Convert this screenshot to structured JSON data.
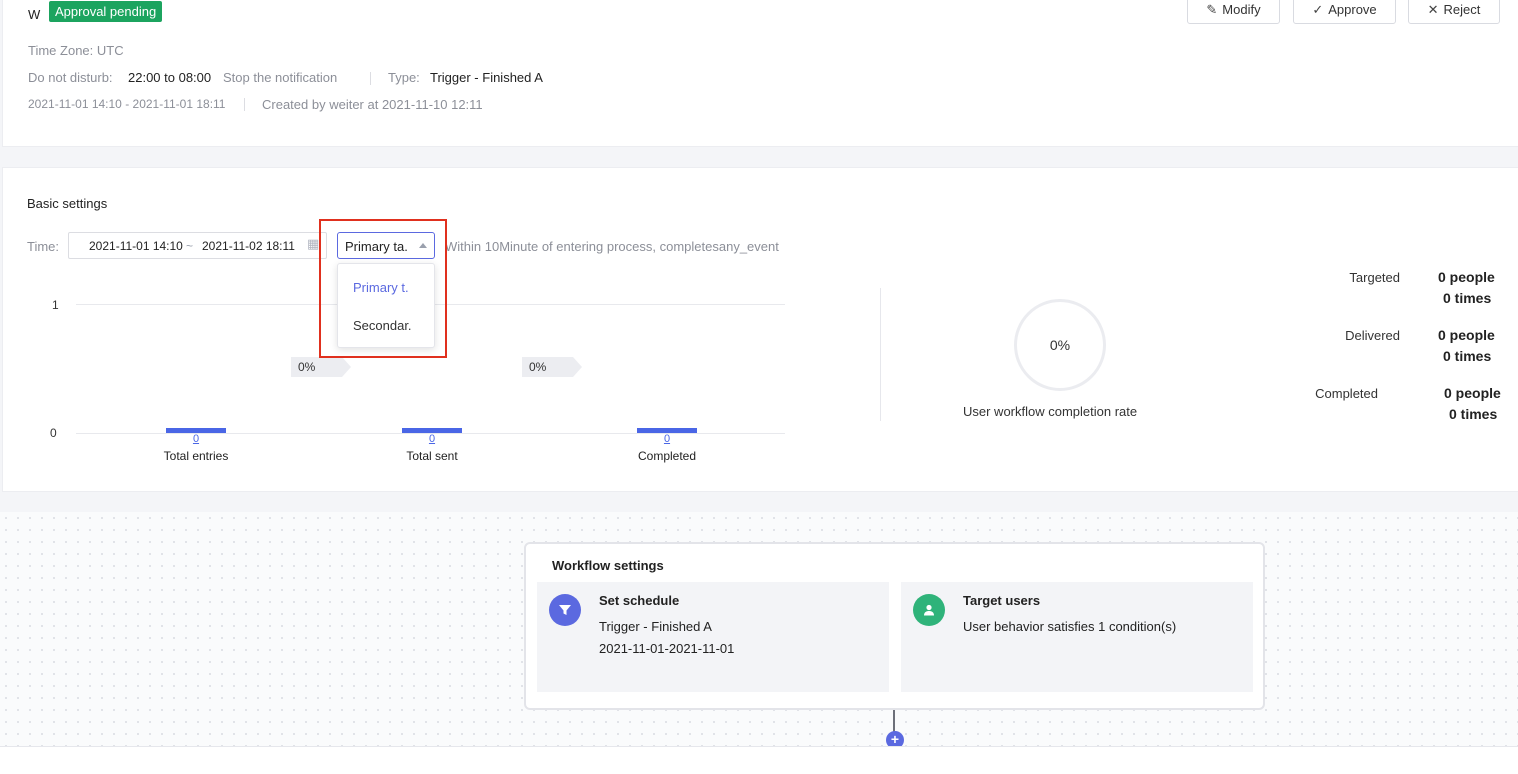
{
  "header": {
    "title_letter": "W",
    "status_badge": "Approval pending",
    "buttons": {
      "modify": "Modify",
      "approve": "Approve",
      "reject": "Reject"
    },
    "time_zone": "Time Zone: UTC",
    "dnd_label": "Do not disturb:",
    "dnd_value": "22:00 to 08:00",
    "dnd_action": "Stop the notification",
    "type_label": "Type:",
    "type_value": "Trigger - Finished A",
    "date_range": "2021-11-01 14:10 - 2021-11-01 18:11",
    "created_by": "Created by weiter at 2021-11-10 12:11"
  },
  "basic": {
    "title": "Basic settings",
    "time_label": "Time:",
    "start_date": "2021-11-01 14:10",
    "range_sep": "~",
    "end_date": "2021-11-02 18:11",
    "target_select": "Primary ta.",
    "target_options": [
      "Primary t.",
      "Secondar."
    ],
    "condition_text": "Within 10Minute of entering process, completesany_event"
  },
  "chart_data": {
    "type": "bar",
    "categories": [
      "Total entries",
      "Total sent",
      "Completed"
    ],
    "values": [
      0,
      0,
      0
    ],
    "ylim": [
      0,
      1
    ],
    "ytick_labels": [
      "1",
      "0"
    ],
    "data_labels": [
      "0",
      "0",
      "0"
    ],
    "conversion_labels": [
      "0%",
      "0%"
    ],
    "bar_color": "#4a66e6"
  },
  "completion": {
    "rate": "0%",
    "label": "User workflow completion rate"
  },
  "stats": [
    {
      "label": "Targeted",
      "people": "0 people",
      "times": "0 times"
    },
    {
      "label": "Delivered",
      "people": "0 people",
      "times": "0 times"
    },
    {
      "label": "Completed",
      "people": "0 people",
      "times": "0 times"
    }
  ],
  "workflow": {
    "title": "Workflow settings",
    "schedule": {
      "icon": "filter-icon",
      "heading": "Set schedule",
      "line1": "Trigger - Finished A",
      "line2": "2021-11-01-2021-11-01"
    },
    "target": {
      "icon": "user-icon",
      "heading": "Target users",
      "line1": "User behavior satisfies 1 condition(s)"
    },
    "add_symbol": "+"
  },
  "colors": {
    "accent": "#5b69e0",
    "success": "#1ca45f",
    "highlight_border": "#e0301e",
    "target_icon": "#2fb37a"
  }
}
